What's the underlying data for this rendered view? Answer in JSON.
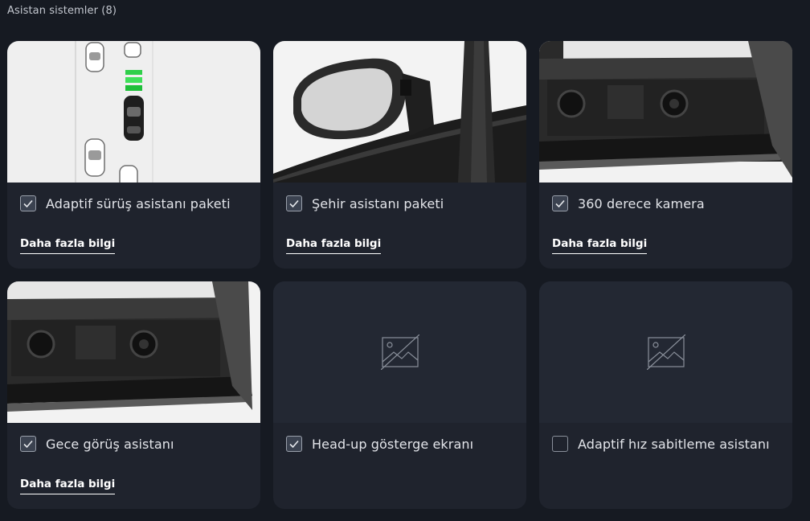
{
  "section": {
    "title": "Asistan sistemler (8)"
  },
  "cards": [
    {
      "label": "Adaptif sürüş asistanı paketi",
      "checked": true,
      "link": "Daha fazla bilgi",
      "image": "adaptive-drive-illustration"
    },
    {
      "label": "Şehir asistanı paketi",
      "checked": true,
      "link": "Daha fazla bilgi",
      "image": "side-mirror-photo"
    },
    {
      "label": "360 derece kamera",
      "checked": true,
      "link": "Daha fazla bilgi",
      "image": "front-camera-photo"
    },
    {
      "label": "Gece görüş asistanı",
      "checked": true,
      "link": "Daha fazla bilgi",
      "image": "front-camera-photo"
    },
    {
      "label": "Head-up gösterge ekranı",
      "checked": true,
      "link": "",
      "image": "image-placeholder-icon"
    },
    {
      "label": "Adaptif hız sabitleme asistanı",
      "checked": false,
      "link": "",
      "image": "image-placeholder-icon"
    }
  ],
  "colors": {
    "background": "#161a22",
    "card": "#1f232d",
    "placeholder": "#232833",
    "checkbox_on": "#3b4250"
  }
}
